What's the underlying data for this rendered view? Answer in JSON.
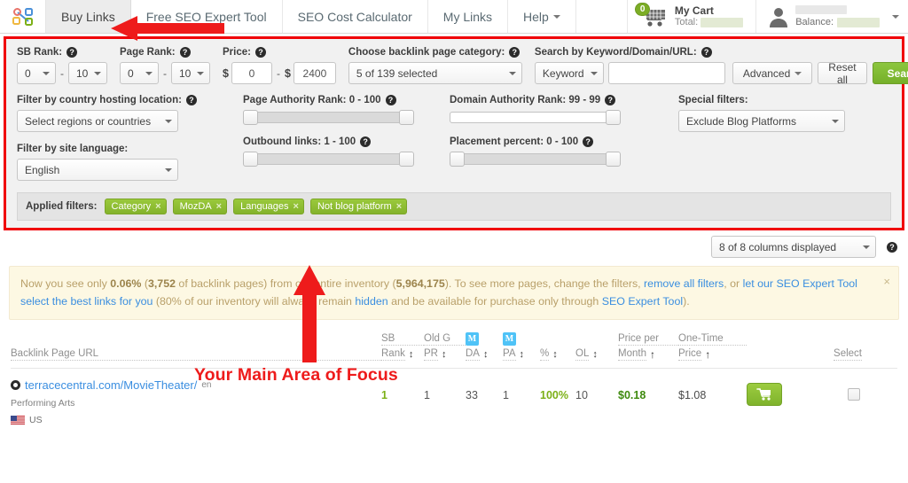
{
  "nav": {
    "logo_icon": "network-nodes-logo",
    "items": [
      {
        "label": "Buy Links",
        "active": true
      },
      {
        "label": "Free SEO Expert Tool",
        "active": false
      },
      {
        "label": "SEO Cost Calculator",
        "active": false
      },
      {
        "label": "My Links",
        "active": false
      },
      {
        "label": "Help",
        "active": false,
        "has_caret": true
      }
    ],
    "cart": {
      "badge": "0",
      "title": "My Cart",
      "total_label": "Total:",
      "total_value_hidden": true
    },
    "user": {
      "name_hidden": true,
      "balance_label": "Balance:",
      "balance_value_hidden": true
    }
  },
  "filters": {
    "sb_rank": {
      "label": "SB Rank:",
      "min": "0",
      "max": "10",
      "separator": "-"
    },
    "page_rank": {
      "label": "Page Rank:",
      "min": "0",
      "max": "10",
      "separator": "-"
    },
    "price": {
      "label": "Price:",
      "currency": "$",
      "min": "0",
      "max": "2400",
      "separator": "-"
    },
    "category": {
      "label": "Choose backlink page category:",
      "value": "5 of 139 selected"
    },
    "search": {
      "label": "Search by Keyword/Domain/URL:",
      "mode": "Keyword",
      "query": "",
      "placeholder": ""
    },
    "advanced_button": "Advanced",
    "reset_button": "Reset all",
    "search_button": "Search",
    "country": {
      "label": "Filter by country hosting location:",
      "value": "Select regions or countries"
    },
    "language": {
      "label": "Filter by site language:",
      "value": "English"
    },
    "page_authority": {
      "label": "Page Authority Rank: 0 - 100",
      "min": 0,
      "max": 100,
      "lo": 0,
      "hi": 100
    },
    "outbound_links": {
      "label": "Outbound links: 1 - 100",
      "min": 1,
      "max": 100,
      "lo": 1,
      "hi": 100
    },
    "domain_authority": {
      "label": "Domain Authority Rank: 99 - 99",
      "min": 99,
      "max": 99,
      "lo": 99,
      "hi": 99
    },
    "placement_percent": {
      "label": "Placement percent: 0 - 100",
      "min": 0,
      "max": 100,
      "lo": 0,
      "hi": 100
    },
    "special": {
      "label": "Special filters:",
      "value": "Exclude Blog Platforms"
    },
    "applied": {
      "label": "Applied filters:",
      "tags": [
        "Category",
        "MozDA",
        "Languages",
        "Not blog platform"
      ],
      "remove_glyph": "×"
    }
  },
  "columns_control": {
    "value": "8 of 8 columns displayed",
    "help_icon": "question-mark-icon"
  },
  "banner": {
    "parts": [
      {
        "t": "Now you see only ",
        "s": "plain"
      },
      {
        "t": "0.06%",
        "s": "bold"
      },
      {
        "t": " (",
        "s": "plain"
      },
      {
        "t": "3,752",
        "s": "bold"
      },
      {
        "t": " of backlink pages) from our entire inventory (",
        "s": "plain"
      },
      {
        "t": "5,964,175",
        "s": "bold"
      },
      {
        "t": "). To see more pages, change the filters, ",
        "s": "plain"
      },
      {
        "t": "remove all filters",
        "s": "link"
      },
      {
        "t": ", or ",
        "s": "plain"
      },
      {
        "t": "let our SEO Expert Tool select the best links for you",
        "s": "link"
      },
      {
        "t": " (80% of our inventory will always remain ",
        "s": "plain"
      },
      {
        "t": "hidden",
        "s": "link"
      },
      {
        "t": " and be available for purchase only through ",
        "s": "plain"
      },
      {
        "t": "SEO Expert Tool",
        "s": "link"
      },
      {
        "t": ").",
        "s": "plain"
      }
    ],
    "close_glyph": "×"
  },
  "annotation": {
    "text": "Your Main Area of Focus",
    "color": "#ee1b1b",
    "arrow_up_icon": "red-up-arrow",
    "arrow_left_icon": "red-left-arrow"
  },
  "table": {
    "headers": {
      "url": "Backlink Page URL",
      "sb_rank_l1": "SB",
      "sb_rank_l2": "Rank",
      "old_g_l1": "Old G",
      "old_g_l2": "PR",
      "da_l1": "M",
      "da_l2": "DA",
      "pa_l1": "M",
      "pa_l2": "PA",
      "percent": "%",
      "ol": "OL",
      "price_month_l1": "Price per",
      "price_month_l2": "Month",
      "one_time_l1": "One-Time",
      "one_time_l2": "Price",
      "select": "Select",
      "sort_glyph": "↕",
      "sort_asc_glyph": "↑"
    },
    "rows": [
      {
        "url": "terracecentral.com/MovieTheater/",
        "url_lang": "en",
        "category": "Performing Arts",
        "country_code": "US",
        "sb_rank": "1",
        "old_g_pr": "1",
        "moz_da": "33",
        "moz_pa": "1",
        "percent": "100%",
        "ol": "10",
        "price_per_month": "$0.18",
        "one_time_price": "$1.08",
        "cart_icon": "shopping-cart-icon",
        "selected": false
      }
    ]
  }
}
